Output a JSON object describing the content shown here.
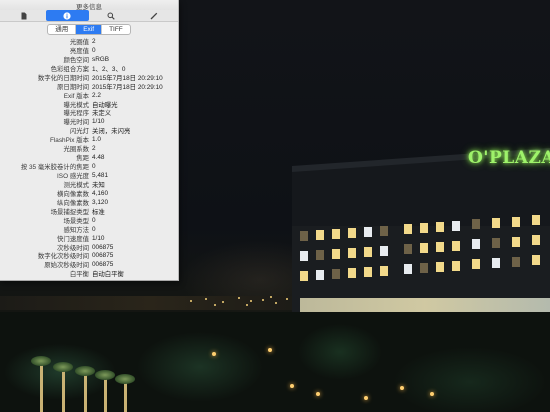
{
  "window": {
    "title": "更多信息",
    "toolbar": [
      {
        "icon": "document-icon",
        "active": false
      },
      {
        "icon": "info-icon",
        "active": true
      },
      {
        "icon": "search-icon",
        "active": false
      },
      {
        "icon": "pencil-icon",
        "active": false
      }
    ],
    "tabs": [
      {
        "label": "通用",
        "active": false
      },
      {
        "label": "Exif",
        "active": true
      },
      {
        "label": "TIFF",
        "active": false
      }
    ]
  },
  "exif": [
    {
      "key": "光圈值",
      "value": "2"
    },
    {
      "key": "亮度值",
      "value": "0"
    },
    {
      "key": "颜色空间",
      "value": "sRGB"
    },
    {
      "key": "色彩组合方案",
      "value": "1、2、3、0"
    },
    {
      "key": "数字化的日期时间",
      "value": "2015年7月18日 20:29:10"
    },
    {
      "key": "原日期时间",
      "value": "2015年7月18日 20:29:10"
    },
    {
      "key": "Exif 版本",
      "value": "2.2"
    },
    {
      "key": "曝光模式",
      "value": "自动曝光"
    },
    {
      "key": "曝光程序",
      "value": "未定义"
    },
    {
      "key": "曝光时间",
      "value": "1/10"
    },
    {
      "key": "闪光灯",
      "value": "关闭，未闪亮"
    },
    {
      "key": "FlashPix 版本",
      "value": "1.0"
    },
    {
      "key": "光圈系数",
      "value": "2"
    },
    {
      "key": "焦距",
      "value": "4.48"
    },
    {
      "key": "按 35 毫米胶卷计的焦距",
      "value": "0"
    },
    {
      "key": "ISO 感光度",
      "value": "5,481"
    },
    {
      "key": "测光模式",
      "value": "未知"
    },
    {
      "key": "横向像素数",
      "value": "4,160"
    },
    {
      "key": "纵向像素数",
      "value": "3,120"
    },
    {
      "key": "场景捕捉类型",
      "value": "标准"
    },
    {
      "key": "场景类型",
      "value": "0"
    },
    {
      "key": "感知方法",
      "value": "0"
    },
    {
      "key": "快门速度值",
      "value": "1/10"
    },
    {
      "key": "次秒级时间",
      "value": "006875"
    },
    {
      "key": "数字化次秒级时间",
      "value": "006875"
    },
    {
      "key": "原始次秒级时间",
      "value": "006875"
    },
    {
      "key": "白平衡",
      "value": "自动白平衡"
    }
  ],
  "photo": {
    "sign_text": "O'PLAZA",
    "sign_color": "#9ef26a"
  }
}
